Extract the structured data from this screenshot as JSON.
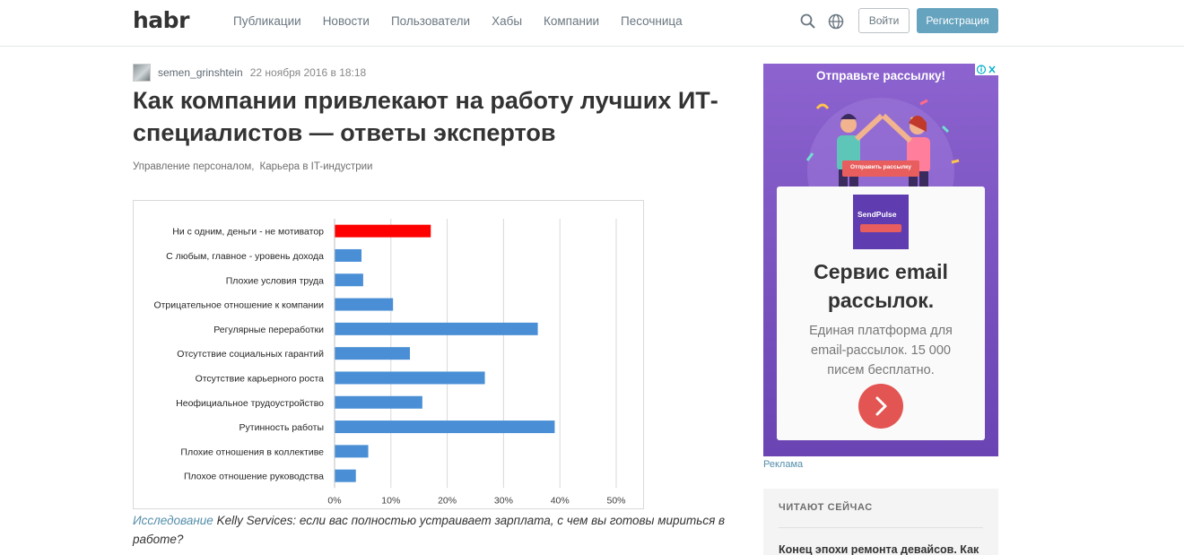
{
  "header": {
    "logo": "habr",
    "nav": [
      "Публикации",
      "Новости",
      "Пользователи",
      "Хабы",
      "Компании",
      "Песочница"
    ],
    "login_label": "Войти",
    "register_label": "Регистрация",
    "icons": [
      "search-icon",
      "globe-icon"
    ]
  },
  "article": {
    "author": "semen_grinshtein",
    "date": "22 ноября 2016 в 18:18",
    "title": "Как компании привлекают на работу лучших ИТ-специалистов — ответы экспертов",
    "hubs": [
      "Управление персоналом,",
      "Карьера в IT-индустрии"
    ],
    "caption_link": "Исследование",
    "caption_text": " Kelly Services: если вас полностью устраивает зарплата, с чем вы готовы мириться в работе?"
  },
  "colors": {
    "accent": "#65a3be",
    "bar": "#4a8fd6",
    "bar_highlight": "#ff0000",
    "ad_bg": "#7d55c2"
  },
  "chart_data": {
    "type": "bar",
    "orientation": "horizontal",
    "categories": [
      "Ни с одним, деньги - не мотиватор",
      "С любым, главное - уровень дохода",
      "Плохие условия труда",
      "Отрицательное отношение  к компании",
      "Регулярные переработки",
      "Отсутствие социальных гарантий",
      "Отсутствие карьерного роста",
      "Неофициальное трудоустройство",
      "Рутинность работы",
      "Плохие отношения  в коллективе",
      "Плохое отношение руководства"
    ],
    "values": [
      17,
      4.7,
      5,
      10.3,
      36,
      13.3,
      26.6,
      15.5,
      39,
      5.9,
      3.7
    ],
    "highlight_index": 0,
    "xticks": [
      "0%",
      "10%",
      "20%",
      "30%",
      "40%",
      "50%"
    ],
    "xlim": [
      0,
      50
    ],
    "grid": true
  },
  "sidebar": {
    "ad": {
      "headline": "Отправьте рассылку!",
      "illustration_button": "Отправить рассылку",
      "logo_text": "SendPulse",
      "title": "Сервис email рассылок.",
      "description": "Единая платформа для email-рассылок. 15 000 писем бесплатно."
    },
    "ad_label": "Реклама",
    "reading_now": {
      "heading": "ЧИТАЮТ СЕЙЧАС",
      "first_item": "Конец эпохи ремонта девайсов. Как"
    }
  }
}
